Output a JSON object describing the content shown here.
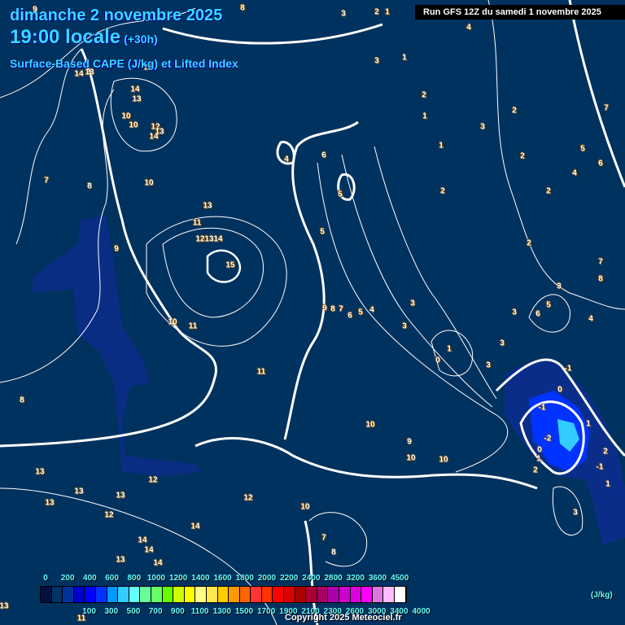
{
  "header": {
    "date": "dimanche 2 novembre 2025",
    "time": "19:00 locale",
    "lead": "(+30h)",
    "subtitle": "Surface-Based CAPE (J/kg) et Lifted Index",
    "run": "Run GFS 12Z du samedi 1 novembre 2025"
  },
  "legend": {
    "unit": "(J/kg)",
    "top_ticks": [
      "0",
      "200",
      "400",
      "600",
      "800",
      "1000",
      "1200",
      "1400",
      "1600",
      "1800",
      "2000",
      "2200",
      "2400",
      "2800",
      "3200",
      "3600",
      "4500"
    ],
    "bottom_ticks": [
      "100",
      "300",
      "500",
      "700",
      "900",
      "1100",
      "1300",
      "1500",
      "1700",
      "1900",
      "2100",
      "2300",
      "2600",
      "3000",
      "3400",
      "4000"
    ],
    "colors": [
      "#001040",
      "#003366",
      "#003399",
      "#0000cc",
      "#0000ff",
      "#0033ff",
      "#0099ff",
      "#33ccff",
      "#66ffff",
      "#66ff99",
      "#66ff66",
      "#66ff00",
      "#ccff00",
      "#ffff00",
      "#ffff88",
      "#ffe84c",
      "#ffcc00",
      "#ff9900",
      "#ff6600",
      "#ff3333",
      "#ff3300",
      "#ff0000",
      "#dd0000",
      "#aa0000",
      "#aa0033",
      "#aa0066",
      "#aa00aa",
      "#cc00cc",
      "#dd00dd",
      "#ff00ff",
      "#dd77dd",
      "#ffbbff",
      "#ffffff"
    ]
  },
  "copyright": "Copyright 2025 Meteociel.fr",
  "li_labels": [
    "9",
    "8",
    "3",
    "2",
    "1",
    "4",
    "3",
    "1",
    "14",
    "13",
    "12",
    "14",
    "13",
    "10",
    "10",
    "12",
    "13",
    "14",
    "2",
    "1",
    "2",
    "3",
    "1",
    "2",
    "5",
    "7",
    "6",
    "4",
    "6",
    "4",
    "5",
    "7",
    "8",
    "10",
    "2",
    "2",
    "13",
    "11",
    "5",
    "12",
    "13",
    "14",
    "9",
    "15",
    "2",
    "7",
    "8",
    "3",
    "5",
    "6",
    "3",
    "4",
    "9",
    "8",
    "7",
    "6",
    "5",
    "4",
    "3",
    "3",
    "10",
    "11",
    "1",
    "0",
    "3",
    "3",
    "-1",
    "0",
    "11",
    "8",
    "-1",
    "-2",
    "1",
    "0",
    "1",
    "2",
    "-1",
    "1",
    "10",
    "9",
    "10",
    "10",
    "2",
    "13",
    "12",
    "13",
    "13",
    "12",
    "13",
    "12",
    "10",
    "3",
    "14",
    "7",
    "14",
    "14",
    "8",
    "13",
    "14",
    "13",
    "11"
  ],
  "colors": {
    "background": "#00325f",
    "title": "#33ddff",
    "contour": "#ffffff"
  }
}
